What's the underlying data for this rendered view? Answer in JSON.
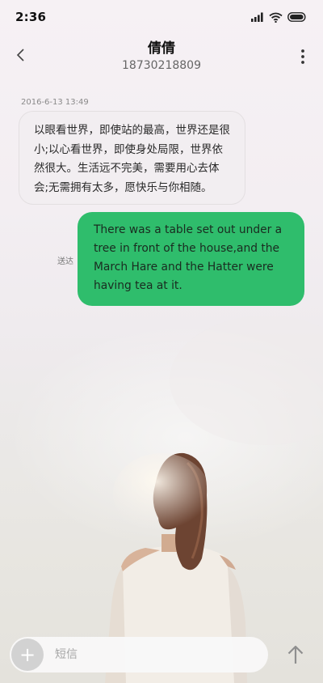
{
  "status_bar": {
    "time": "2:36",
    "icons": [
      "signal-icon",
      "wifi-icon",
      "battery-icon"
    ]
  },
  "header": {
    "contact_name": "倩倩",
    "phone_number": "18730218809",
    "back_icon": "chevron-left-icon",
    "more_icon": "more-vertical-icon"
  },
  "conversation": {
    "timestamp": "2016-6-13 13:49",
    "received_message": "以眼看世界，即使站的最高，世界还是很小;以心看世界，即使身处局限，世界依然很大。生活远不完美，需要用心去体会;无需拥有太多，愿快乐与你相随。",
    "sent_status": "送达",
    "sent_message": "There was a table set out under a tree in front of the house,and the March Hare and the Hatter were having tea at it."
  },
  "compose": {
    "placeholder": "短信",
    "add_label": "+",
    "send_icon": "arrow-up-icon"
  },
  "colors": {
    "sent_bubble": "#2fbd6c",
    "received_bubble": "#f1eef0"
  }
}
